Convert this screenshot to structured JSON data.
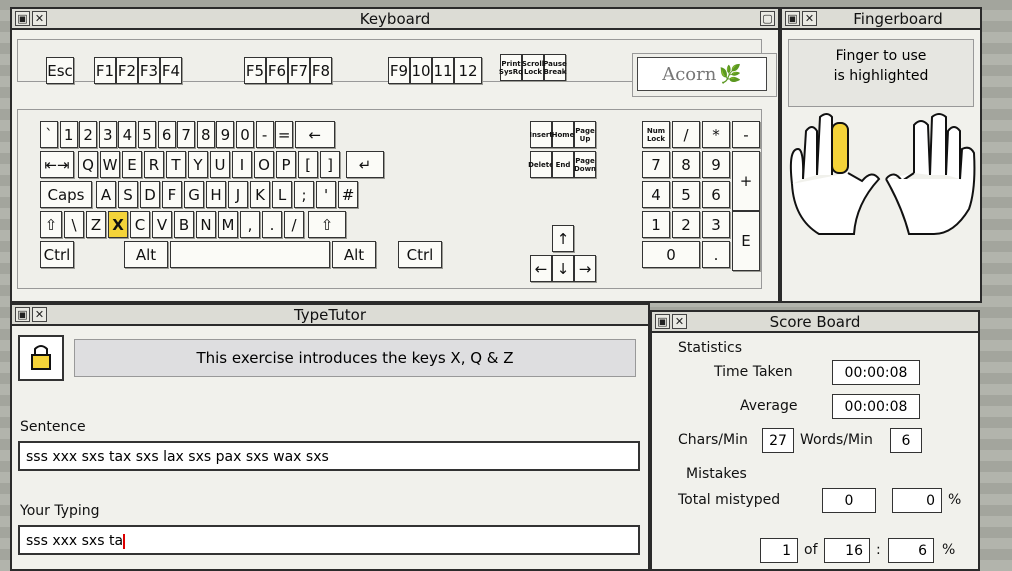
{
  "keyboard_window": {
    "title": "Keyboard",
    "logo": "Acorn",
    "frow": [
      "Esc",
      "F1",
      "F2",
      "F3",
      "F4",
      "F5",
      "F6",
      "F7",
      "F8",
      "F9",
      "10",
      "11",
      "12"
    ],
    "sys": [
      "Print SysRq",
      "Scroll Lock",
      "Pause Break"
    ],
    "row1": [
      "`",
      "1",
      "2",
      "3",
      "4",
      "5",
      "6",
      "7",
      "8",
      "9",
      "0",
      "-",
      "=",
      "←"
    ],
    "row2": [
      "Q",
      "W",
      "E",
      "R",
      "T",
      "Y",
      "U",
      "I",
      "O",
      "P",
      "[",
      "]"
    ],
    "row3": [
      "A",
      "S",
      "D",
      "F",
      "G",
      "H",
      "J",
      "K",
      "L",
      ";",
      "'",
      "#"
    ],
    "row4": [
      "\\",
      "Z",
      "X",
      "C",
      "V",
      "B",
      "N",
      "M",
      ",",
      ".",
      "/"
    ],
    "caps": "Caps",
    "ctrl": "Ctrl",
    "alt": "Alt",
    "tab": "⇤⇥",
    "enter": "↵",
    "shift": "⇧",
    "nav": [
      "Insert",
      "Home",
      "Page Up",
      "Delete",
      "End",
      "Page Down"
    ],
    "arrows": [
      "↑",
      "←",
      "↓",
      "→"
    ],
    "num": [
      "Num Lock",
      "/",
      "*",
      "-",
      "7",
      "8",
      "9",
      "+",
      "4",
      "5",
      "6",
      "1",
      "2",
      "3",
      "E",
      "0",
      "."
    ],
    "highlighted_key": "X"
  },
  "fingerboard_window": {
    "title": "Fingerboard",
    "line1": "Finger to use",
    "line2": "is highlighted",
    "highlight_color": "#f4d339"
  },
  "typetutor_window": {
    "title": "TypeTutor",
    "message": "This exercise introduces the keys X, Q & Z",
    "sentence_label": "Sentence",
    "sentence": "sss xxx sxs tax sxs lax sxs pax sxs wax sxs",
    "typing_label": "Your Typing",
    "typing": "sss xxx sxs ta"
  },
  "scoreboard_window": {
    "title": "Score Board",
    "statistics_label": "Statistics",
    "time_taken_label": "Time Taken",
    "time_taken": "00:00:08",
    "average_label": "Average",
    "average": "00:00:08",
    "chars_min_label": "Chars/Min",
    "chars_min": "27",
    "words_min_label": "Words/Min",
    "words_min": "6",
    "mistakes_label": "Mistakes",
    "total_mistyped_label": "Total mistyped",
    "total_mistyped": "0",
    "mistyped_pct": "0",
    "pct": "%",
    "progress_current": "1",
    "of": "of",
    "progress_total": "16",
    "progress_sep": ":",
    "progress_pct": "6"
  }
}
